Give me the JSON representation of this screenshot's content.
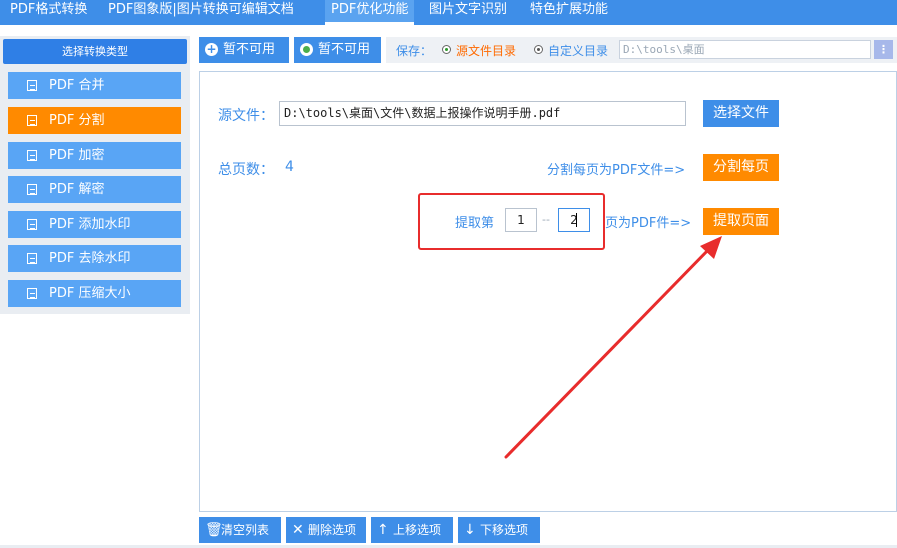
{
  "top_tabs": [
    {
      "label": "PDF格式转换"
    },
    {
      "label": "PDF图象版|图片转换可编辑文档"
    },
    {
      "label": "PDF优化功能"
    },
    {
      "label": "图片文字识别"
    },
    {
      "label": "特色扩展功能"
    }
  ],
  "sidebar": {
    "title": "选择转换类型",
    "items": [
      {
        "label": "PDF 合并"
      },
      {
        "label": "PDF 分割"
      },
      {
        "label": "PDF 加密"
      },
      {
        "label": "PDF 解密"
      },
      {
        "label": "PDF 添加水印"
      },
      {
        "label": "PDF 去除水印"
      },
      {
        "label": "PDF 压缩大小"
      }
    ]
  },
  "toolbar": {
    "btn1": "暂不可用",
    "btn2": "暂不可用",
    "save_label": "保存：",
    "option_source": "源文件目录",
    "option_custom": "自定义目录",
    "custom_path": "D:\\tools\\桌面"
  },
  "main": {
    "source_label": "源文件：",
    "source_path": "D:\\tools\\桌面\\文件\\数据上报操作说明手册.pdf",
    "choose_file": "选择文件",
    "total_label": "总页数：",
    "total_pages": "4",
    "split_each_text": "分割每页为PDF文件=>",
    "split_each_btn": "分割每页",
    "extract_prefix": "提取第",
    "page_from": "1",
    "separator": "--",
    "page_to": "2",
    "extract_suffix": "页为PDF件=>",
    "extract_btn": "提取页面"
  },
  "bottom": {
    "clear": "清空列表",
    "delete": "删除选项",
    "up": "上移选项",
    "down": "下移选项"
  },
  "colors": {
    "accent": "#3e8ee8",
    "orange": "#ff8a00",
    "highlight": "#e82c2c"
  }
}
